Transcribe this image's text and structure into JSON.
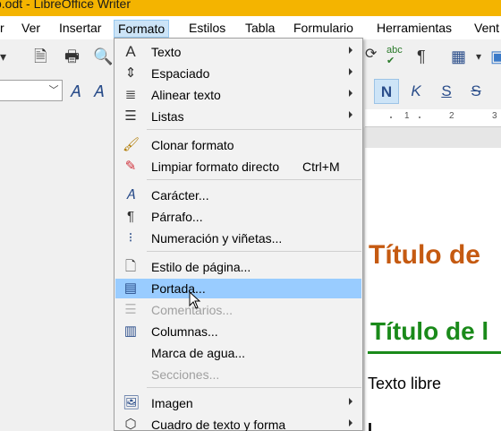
{
  "window": {
    "title": "o.odt - LibreOffice Writer"
  },
  "menubar": {
    "items": [
      "r",
      "Ver",
      "Insertar",
      "Formato",
      "Estilos",
      "Tabla",
      "Formulario",
      "Herramientas",
      "Vent"
    ],
    "active": "Formato"
  },
  "format_menu": {
    "items": [
      {
        "label": "Texto",
        "icon": "text-A-icon",
        "submenu": true
      },
      {
        "label": "Espaciado",
        "icon": "spacing-icon",
        "submenu": true
      },
      {
        "label": "Alinear texto",
        "icon": "align-text-icon",
        "submenu": true
      },
      {
        "label": "Listas",
        "icon": "list-icon",
        "submenu": true
      },
      {
        "label": "Clonar formato",
        "icon": "clone-brush-icon"
      },
      {
        "label": "Limpiar formato directo",
        "icon": "eraser-icon",
        "shortcut": "Ctrl+M"
      },
      {
        "label": "Carácter...",
        "icon": "character-icon"
      },
      {
        "label": "Párrafo...",
        "icon": "paragraph-icon"
      },
      {
        "label": "Numeración y viñetas...",
        "icon": "bullets-numbering-icon"
      },
      {
        "label": "Estilo de página...",
        "icon": "page-style-icon"
      },
      {
        "label": "Portada...",
        "icon": "title-page-icon",
        "highlighted": true
      },
      {
        "label": "Comentarios...",
        "icon": "comments-icon",
        "disabled": true
      },
      {
        "label": "Columnas...",
        "icon": "columns-icon"
      },
      {
        "label": "Marca de agua...",
        "icon": "watermark-icon"
      },
      {
        "label": "Secciones...",
        "icon": "sections-icon",
        "disabled": true
      },
      {
        "label": "Imagen",
        "icon": "image-icon",
        "submenu": true
      },
      {
        "label": "Cuadro de texto y forma",
        "icon": "textbox-shape-icon",
        "submenu": true
      }
    ]
  },
  "toolbar": {
    "bold": "N",
    "italic": "K",
    "underline": "S",
    "strike": "S"
  },
  "ruler": {
    "ticks": [
      "1",
      "2",
      "3"
    ]
  },
  "document": {
    "heading1": "Título de",
    "heading2": "Título de l",
    "body": "Texto libre"
  },
  "colors": {
    "titlebar": "#f4b400",
    "heading1": "#c55a11",
    "heading2": "#1a8a1a",
    "menu_highlight": "#99ccff"
  }
}
